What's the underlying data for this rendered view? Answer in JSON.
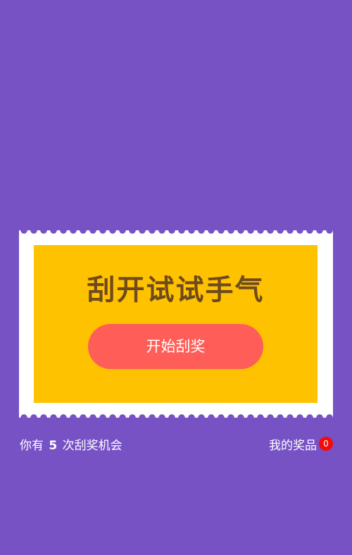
{
  "colors": {
    "background": "#7752c5",
    "ticket": "#ffffff",
    "scratch_area": "#fec200",
    "headline": "#6e4a1c",
    "button": "#fe5e57",
    "badge": "#f50a0a"
  },
  "card": {
    "headline": "刮开试试手气",
    "start_button_label": "开始刮奖"
  },
  "footer": {
    "chances_prefix": "你有",
    "chances_count": "5",
    "chances_suffix": "次刮奖机会",
    "prizes_label": "我的奖品",
    "prizes_badge": "0"
  }
}
